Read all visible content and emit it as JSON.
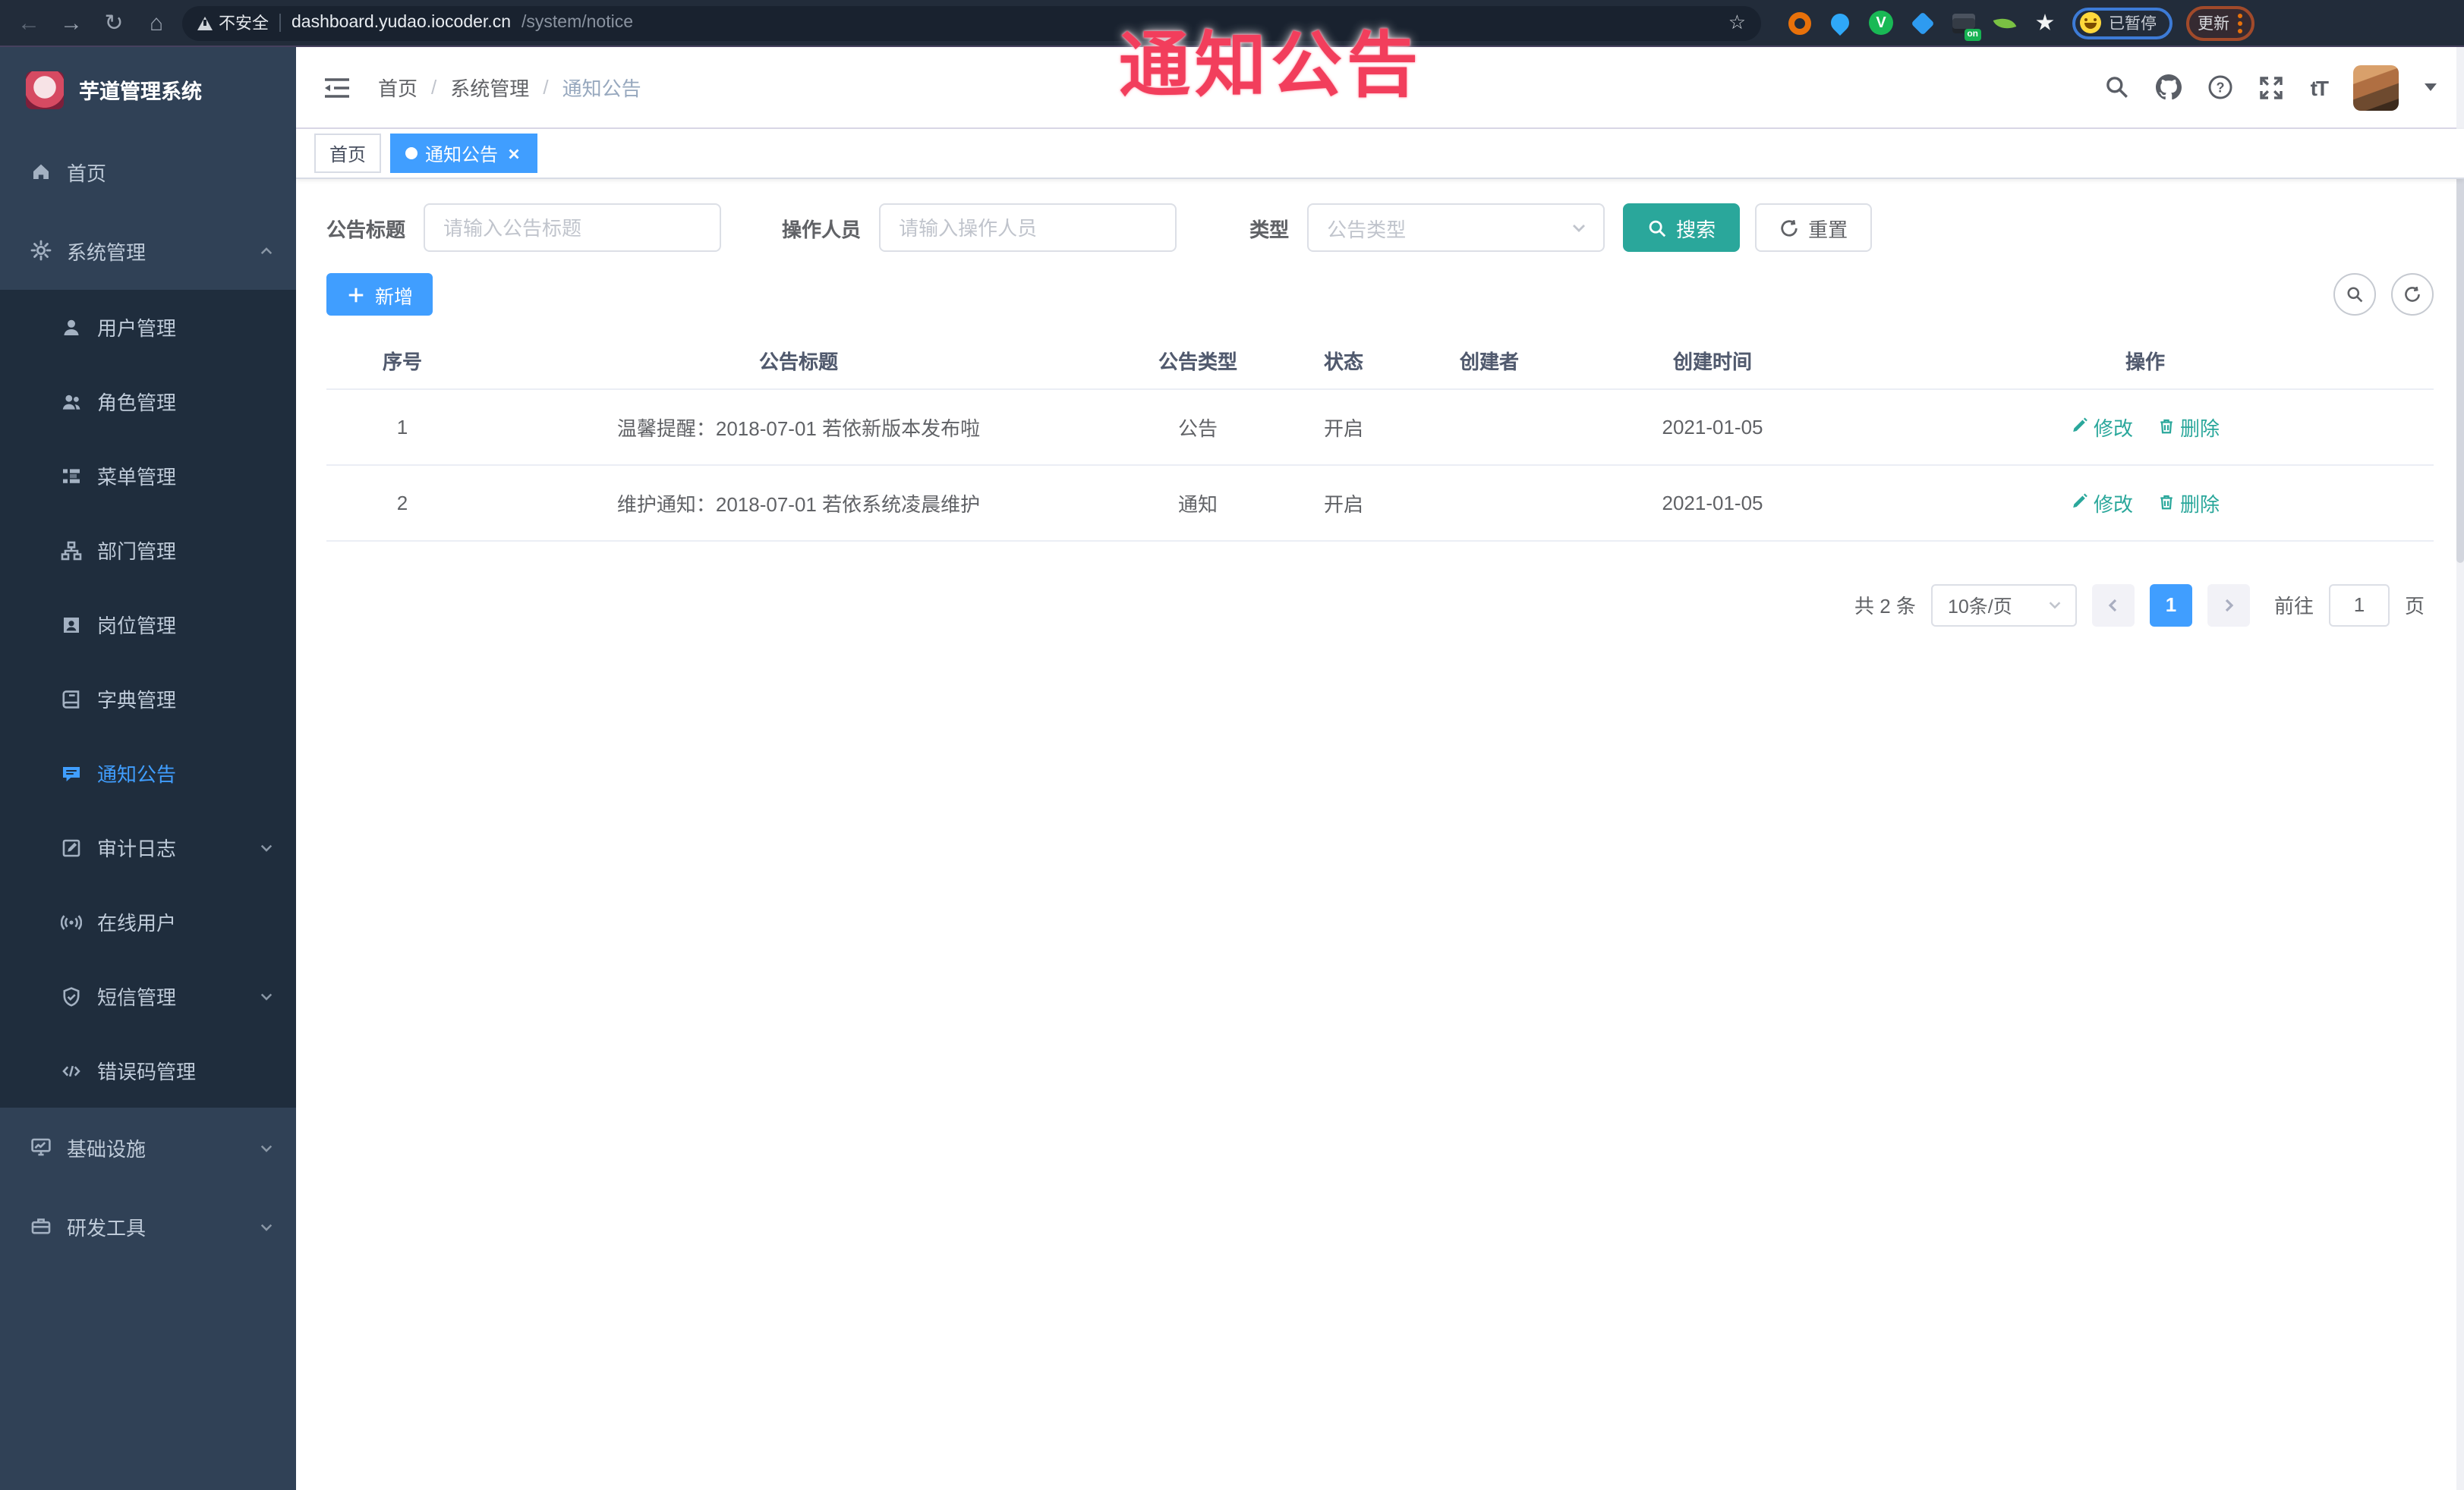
{
  "colors": {
    "primary": "#409EFF",
    "theme_teal": "#2AA79B",
    "watermark_red": "#F23E5C",
    "sidebar_bg": "#304156",
    "submenu_bg": "#1F2D3D",
    "chrome_bg": "#222C3A"
  },
  "watermark": "通知公告",
  "browser": {
    "security_label": "不安全",
    "url_host": "dashboard.yudao.iocoder.cn",
    "url_path": "/system/notice",
    "extension_badge": "on",
    "profile_status": "已暂停",
    "update_label": "更新"
  },
  "sidebar": {
    "title": "芋道管理系统",
    "items": [
      {
        "label": "首页",
        "icon": "dashboard-icon"
      },
      {
        "label": "系统管理",
        "icon": "gear-icon",
        "expanded": true
      },
      {
        "label": "用户管理",
        "icon": "user-icon"
      },
      {
        "label": "角色管理",
        "icon": "role-icon"
      },
      {
        "label": "菜单管理",
        "icon": "menu-tree-icon"
      },
      {
        "label": "部门管理",
        "icon": "org-tree-icon"
      },
      {
        "label": "岗位管理",
        "icon": "post-icon"
      },
      {
        "label": "字典管理",
        "icon": "dict-icon"
      },
      {
        "label": "通知公告",
        "icon": "notice-icon",
        "active": true
      },
      {
        "label": "审计日志",
        "icon": "log-icon",
        "expandable": true
      },
      {
        "label": "在线用户",
        "icon": "online-user-icon"
      },
      {
        "label": "短信管理",
        "icon": "sms-icon",
        "expandable": true
      },
      {
        "label": "错误码管理",
        "icon": "error-code-icon"
      },
      {
        "label": "基础设施",
        "icon": "infra-icon",
        "expandable": true
      },
      {
        "label": "研发工具",
        "icon": "devtool-icon",
        "expandable": true
      }
    ]
  },
  "header": {
    "breadcrumb": [
      "首页",
      "系统管理",
      "通知公告"
    ],
    "separator": "/"
  },
  "tabs": [
    {
      "label": "首页",
      "active": false
    },
    {
      "label": "通知公告",
      "active": true,
      "closable": true
    }
  ],
  "filters": {
    "title_label": "公告标题",
    "title_placeholder": "请输入公告标题",
    "operator_label": "操作人员",
    "operator_placeholder": "请输入操作人员",
    "type_label": "类型",
    "type_placeholder": "公告类型",
    "search_label": "搜索",
    "reset_label": "重置"
  },
  "toolbar": {
    "add_label": "新增"
  },
  "table": {
    "columns": [
      "序号",
      "公告标题",
      "公告类型",
      "状态",
      "创建者",
      "创建时间",
      "操作"
    ],
    "rows": [
      {
        "index": "1",
        "title": "温馨提醒：2018-07-01 若依新版本发布啦",
        "type": "公告",
        "status": "开启",
        "creator": "",
        "created_at": "2021-01-05",
        "edit": "修改",
        "delete": "删除"
      },
      {
        "index": "2",
        "title": "维护通知：2018-07-01 若依系统凌晨维护",
        "type": "通知",
        "status": "开启",
        "creator": "",
        "created_at": "2021-01-05",
        "edit": "修改",
        "delete": "删除"
      }
    ]
  },
  "pagination": {
    "total": "共 2 条",
    "page_size": "10条/页",
    "current_page": "1",
    "goto_label": "前往",
    "goto_value": "1",
    "page_unit": "页"
  }
}
